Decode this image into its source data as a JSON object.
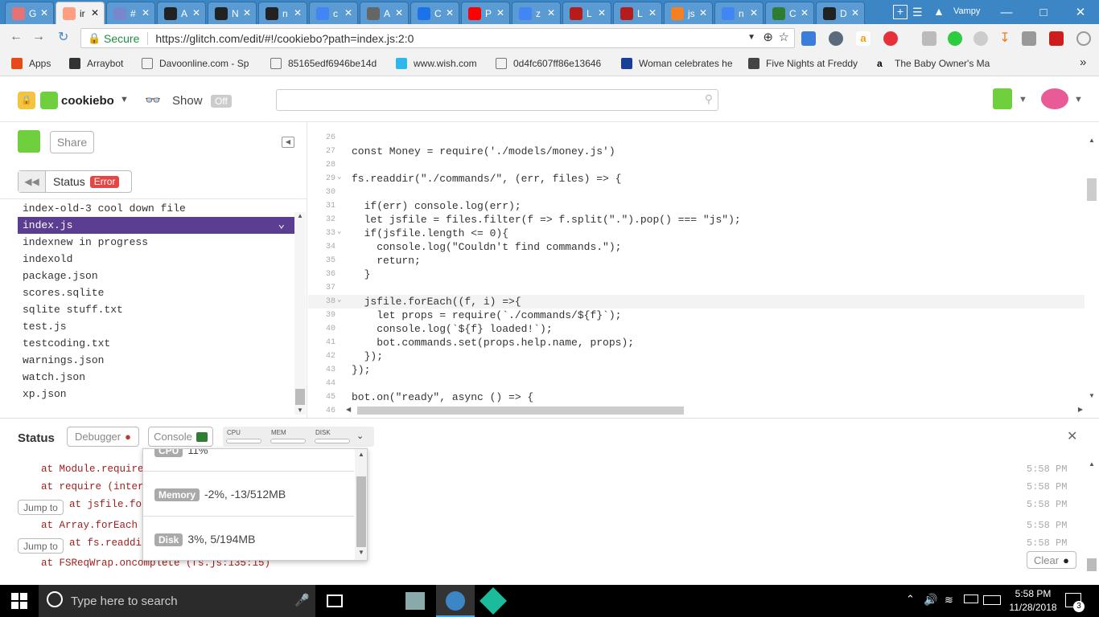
{
  "browser": {
    "tabs": [
      {
        "title": "G",
        "color": "#e57373"
      },
      {
        "title": "ir",
        "color": "#ff9e80",
        "active": true
      },
      {
        "title": "#",
        "color": "#7986cb"
      },
      {
        "title": "A",
        "color": "#222222"
      },
      {
        "title": "N",
        "color": "#222222"
      },
      {
        "title": "n",
        "color": "#222222"
      },
      {
        "title": "c",
        "color": "#4285f4"
      },
      {
        "title": "A",
        "color": "#666666"
      },
      {
        "title": "C",
        "color": "#1a73e8"
      },
      {
        "title": "P",
        "color": "#ff0000"
      },
      {
        "title": "z",
        "color": "#4285f4"
      },
      {
        "title": "L",
        "color": "#b71c1c"
      },
      {
        "title": "L",
        "color": "#b71c1c"
      },
      {
        "title": "js",
        "color": "#f48024"
      },
      {
        "title": "n",
        "color": "#4285f4"
      },
      {
        "title": "C",
        "color": "#2e7d32"
      },
      {
        "title": "D",
        "color": "#222222"
      }
    ],
    "profile": "Vampy",
    "secure_label": "Secure",
    "url": "https://glitch.com/edit/#!/cookiebo?path=index.js:2:0",
    "bookmarks": [
      "Apps",
      "Arraybot",
      "Davoonline.com - Sp",
      "85165edf6946be14d",
      "www.wish.com",
      "0d4fc607ff86e13646",
      "Woman celebrates he",
      "Five Nights at Freddy",
      "The Baby Owner's Ma"
    ],
    "bookmarks_more": "»"
  },
  "glitch": {
    "project": "cookiebo",
    "show_label": "Show",
    "show_state": "Off",
    "share_label": "Share",
    "status_label": "Status",
    "status_badge": "Error",
    "files": [
      "index-old-3 cool down file",
      "index.js",
      "indexnew in progress",
      "indexold",
      "package.json",
      "scores.sqlite",
      "sqlite stuff.txt",
      "test.js",
      "testcoding.txt",
      "warnings.json",
      "watch.json",
      "xp.json"
    ],
    "active_file": "index.js"
  },
  "editor": {
    "lines": [
      {
        "n": "26",
        "code": ""
      },
      {
        "n": "27",
        "code": "const Money = require('./models/money.js')"
      },
      {
        "n": "28",
        "code": ""
      },
      {
        "n": "29",
        "code": "fs.readdir(\"./commands/\", (err, files) => {"
      },
      {
        "n": "30",
        "code": ""
      },
      {
        "n": "31",
        "code": "  if(err) console.log(err);"
      },
      {
        "n": "32",
        "code": "  let jsfile = files.filter(f => f.split(\".\").pop() === \"js\");"
      },
      {
        "n": "33",
        "code": "  if(jsfile.length <= 0){"
      },
      {
        "n": "34",
        "code": "    console.log(\"Couldn't find commands.\");"
      },
      {
        "n": "35",
        "code": "    return;"
      },
      {
        "n": "36",
        "code": "  }"
      },
      {
        "n": "37",
        "code": ""
      },
      {
        "n": "38",
        "code": "  jsfile.forEach((f, i) =>{"
      },
      {
        "n": "39",
        "code": "    let props = require(`./commands/${f}`);"
      },
      {
        "n": "40",
        "code": "    console.log(`${f} loaded!`);"
      },
      {
        "n": "41",
        "code": "    bot.commands.set(props.help.name, props);"
      },
      {
        "n": "42",
        "code": "  });"
      },
      {
        "n": "43",
        "code": "});"
      },
      {
        "n": "44",
        "code": ""
      },
      {
        "n": "45",
        "code": "bot.on(\"ready\", async () => {"
      },
      {
        "n": "46",
        "code": ""
      }
    ]
  },
  "status_panel": {
    "title": "Status",
    "debugger_label": "Debugger",
    "console_label": "Console",
    "meters": [
      "CPU",
      "MEM",
      "DISK"
    ],
    "logs": [
      {
        "text": "at Module.require",
        "time": "5:58 PM",
        "jump": false
      },
      {
        "text": "at require (intern",
        "time": "5:58 PM",
        "jump": false
      },
      {
        "text": "at jsfile.for",
        "time": "5:58 PM",
        "jump": true
      },
      {
        "text": "at Array.forEach",
        "time": "5:58 PM",
        "jump": false
      },
      {
        "text": "at fs.readdir",
        "time": "5:58 PM",
        "jump": true
      },
      {
        "text": "at FSReqWrap.oncomplete (fs.js:135:15)",
        "time": "",
        "jump": false
      }
    ],
    "jump_label": "Jump to",
    "clear_label": "Clear",
    "resources": [
      {
        "label": "CPU",
        "value": "11%"
      },
      {
        "label": "Memory",
        "value": "-2%, -13/512MB"
      },
      {
        "label": "Disk",
        "value": "3%, 5/194MB"
      }
    ]
  },
  "taskbar": {
    "search_placeholder": "Type here to search",
    "time": "5:58 PM",
    "date": "11/28/2018",
    "notifications": "3"
  }
}
